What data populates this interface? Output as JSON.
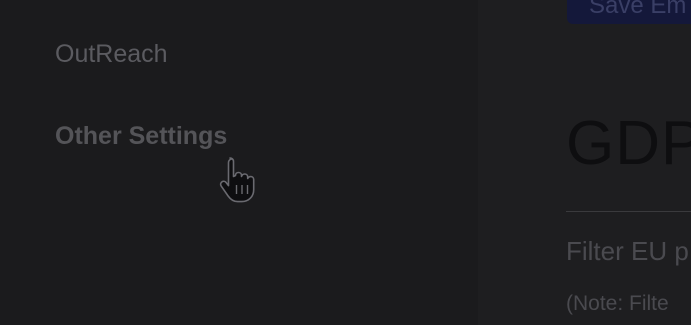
{
  "sidebar": {
    "items": [
      {
        "label": "OutReach"
      },
      {
        "label": "Other Settings"
      }
    ]
  },
  "main": {
    "save_button_label": "Save Em",
    "section_title": "GDP",
    "filter_label": "Filter EU p",
    "note": "(Note: Filte"
  },
  "colors": {
    "overlay_background": "#1d1d1f",
    "button_background": "#14183a"
  },
  "icons": {
    "cursor": "hand-pointer-icon"
  }
}
